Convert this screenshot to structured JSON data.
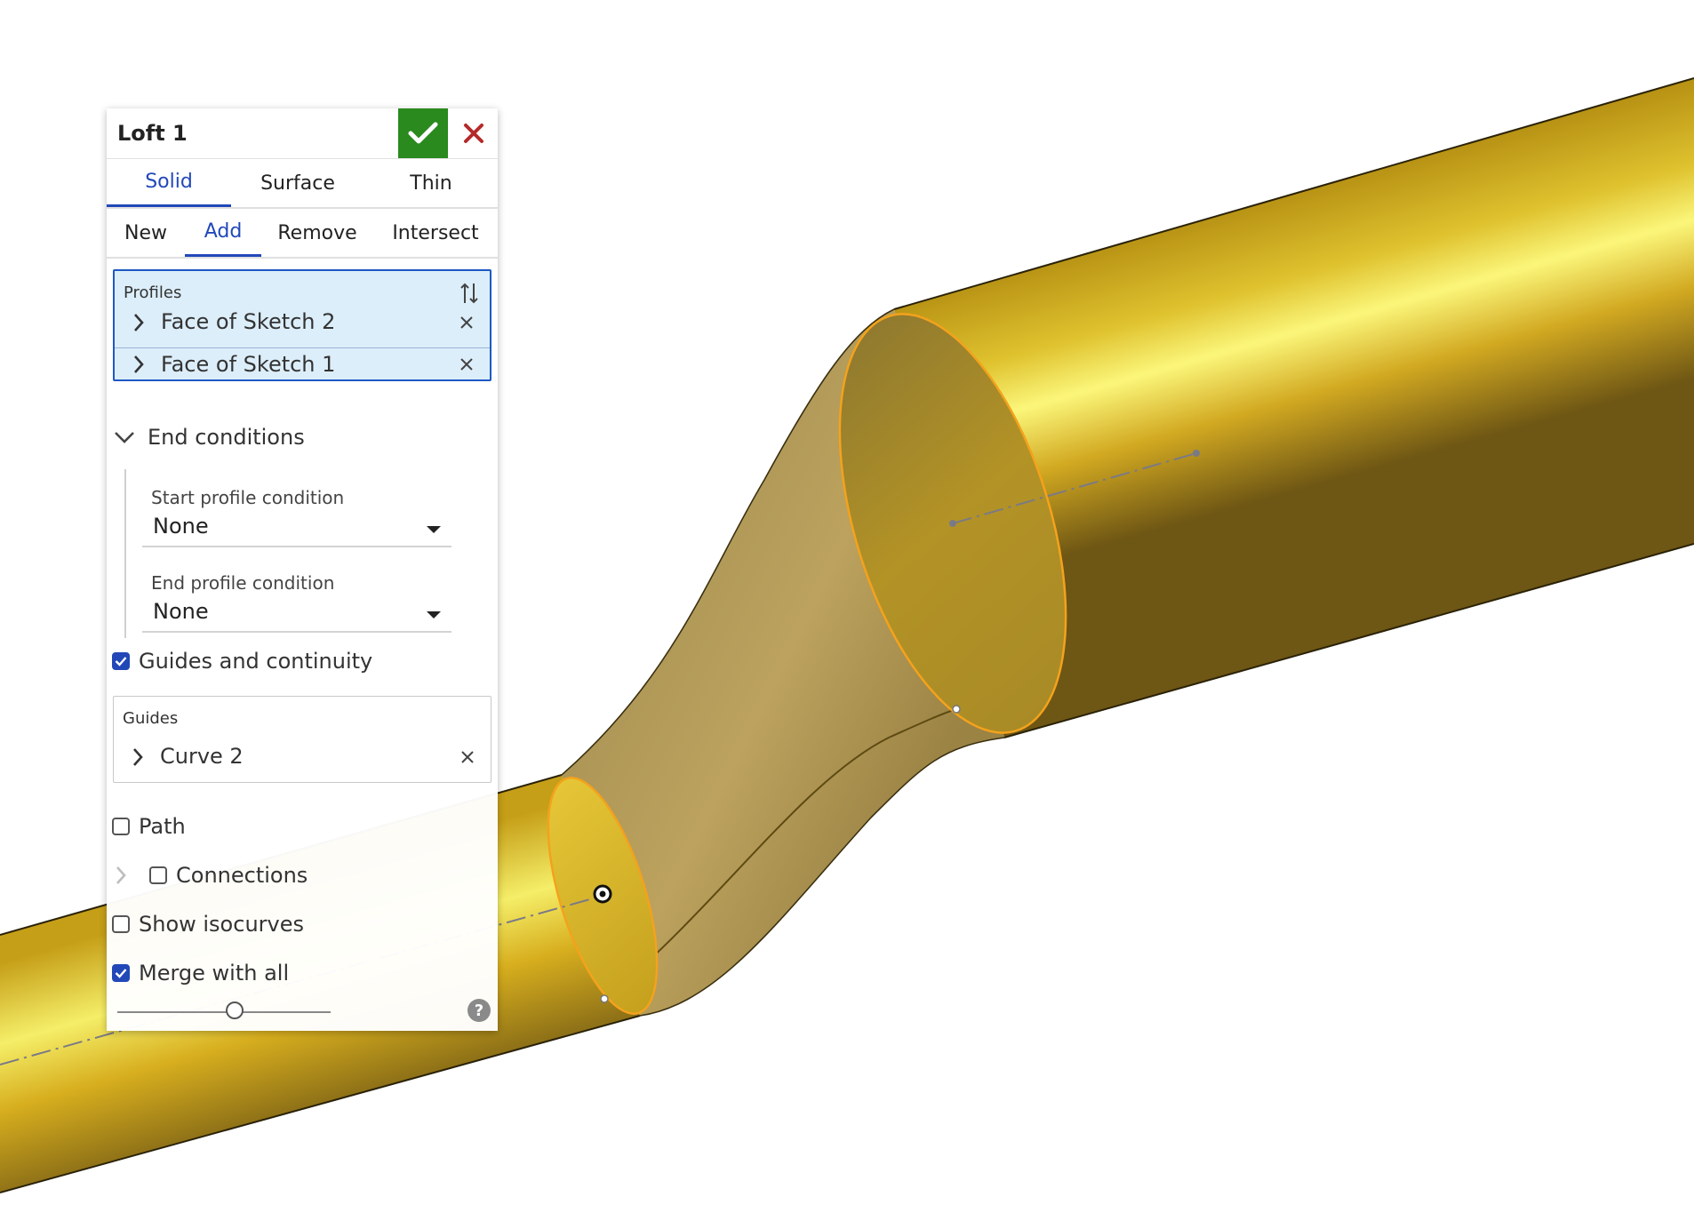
{
  "dialog": {
    "title": "Loft 1",
    "accept_icon": "check-icon",
    "cancel_icon": "close-icon",
    "type_tabs": [
      {
        "label": "Solid",
        "active": true
      },
      {
        "label": "Surface",
        "active": false
      },
      {
        "label": "Thin",
        "active": false
      }
    ],
    "operation_tabs": [
      {
        "label": "New",
        "active": false
      },
      {
        "label": "Add",
        "active": true
      },
      {
        "label": "Remove",
        "active": false
      },
      {
        "label": "Intersect",
        "active": false
      }
    ],
    "profiles": {
      "label": "Profiles",
      "items": [
        "Face of Sketch 2",
        "Face of Sketch 1"
      ]
    },
    "end_conditions": {
      "label": "End conditions",
      "expanded": true,
      "start_label": "Start profile condition",
      "start_value": "None",
      "end_label": "End profile condition",
      "end_value": "None"
    },
    "guides_and_continuity": {
      "label": "Guides and continuity",
      "checked": true
    },
    "guides": {
      "label": "Guides",
      "items": [
        "Curve 2"
      ]
    },
    "path": {
      "label": "Path",
      "checked": false
    },
    "connections": {
      "label": "Connections",
      "checked": false
    },
    "show_isocurves": {
      "label": "Show isocurves",
      "checked": false
    },
    "merge_with_all": {
      "label": "Merge with all",
      "checked": true
    },
    "transparency_slider": 0.55,
    "help_icon": "?"
  },
  "colors": {
    "accent": "#2248b8",
    "accept": "#2a8a1e",
    "cancel": "#b52a2a",
    "selection_fill": "#dceefa",
    "part_gold": "#d8b21c",
    "edge_highlight": "#f4a21c"
  }
}
